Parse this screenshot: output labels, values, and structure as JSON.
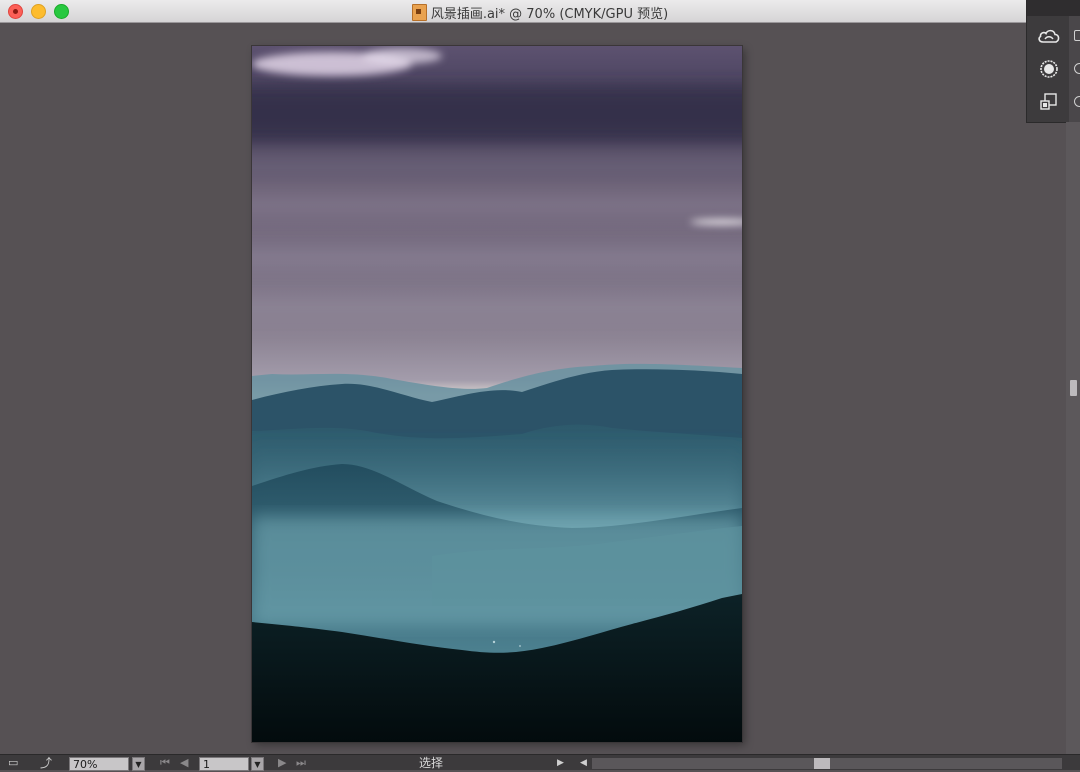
{
  "window": {
    "title": "风景插画.ai* @ 70% (CMYK/GPU 预览)"
  },
  "panel": {
    "tools": [
      "creative-cloud-libraries",
      "color-wheel",
      "artboards"
    ]
  },
  "statusbar": {
    "zoom_value": "70%",
    "artboard_value": "1",
    "current_tool": "选择"
  },
  "artwork": {
    "subject": "misty mountain landscape at dusk",
    "colors": {
      "sky_top": "#5b4f68",
      "sky_horizon": "#e2dcd6",
      "ridge_far": "#5f8998",
      "ridge_mid": "#2f5a6e",
      "fog": "#7fb2bd",
      "foreground": "#061215"
    }
  },
  "colors": {
    "canvas_bg": "#565154",
    "panel_bg": "#3d3b3d",
    "statusbar_bg": "#3c3a3c",
    "title_bar": "#e3e1e3"
  }
}
